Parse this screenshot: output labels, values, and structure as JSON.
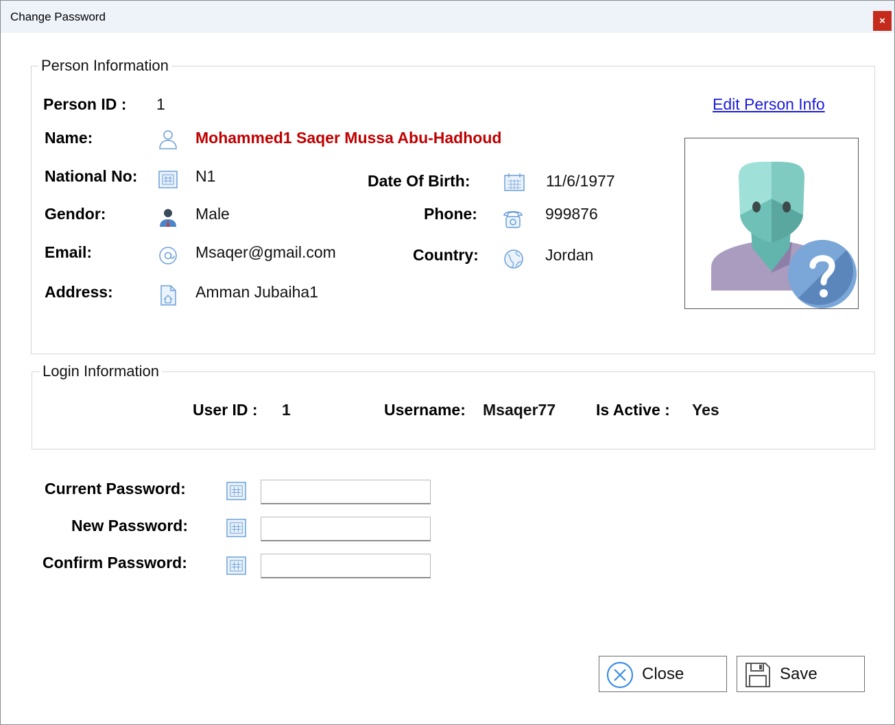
{
  "window": {
    "title": "Change Password",
    "close_glyph": "×"
  },
  "person_info": {
    "legend": "Person Information",
    "person_id_label": "Person ID :",
    "person_id": "1",
    "edit_link": "Edit Person Info",
    "name_label": "Name:",
    "name": "Mohammed1 Saqer Mussa Abu-Hadhoud",
    "national_no_label": "National No:",
    "national_no": "N1",
    "dob_label": "Date Of Birth:",
    "dob": "11/6/1977",
    "gender_label": "Gendor:",
    "gender": "Male",
    "phone_label": "Phone:",
    "phone": "999876",
    "email_label": "Email:",
    "email": "Msaqer@gmail.com",
    "country_label": "Country:",
    "country": "Jordan",
    "address_label": "Address:",
    "address": "Amman Jubaiha1"
  },
  "login_info": {
    "legend": "Login Information",
    "user_id_label": "User ID :",
    "user_id": "1",
    "username_label": "Username:",
    "username": "Msaqer77",
    "is_active_label": "Is Active :",
    "is_active": "Yes"
  },
  "password_form": {
    "current_label": "Current Password:",
    "current_value": "",
    "new_label": "New Password:",
    "new_value": "",
    "confirm_label": "Confirm Password:",
    "confirm_value": ""
  },
  "buttons": {
    "close_label": "Close",
    "save_label": "Save"
  },
  "colors": {
    "name_red": "#c00000",
    "link_blue": "#1a1adb",
    "close_red": "#c42b1c",
    "icon_blue": "#4a86c8"
  },
  "icons": [
    "person-outline-icon",
    "id-card-icon",
    "calendar-icon",
    "male-user-icon",
    "phone-icon",
    "at-sign-icon",
    "globe-icon",
    "address-doc-icon",
    "unknown-person-photo",
    "close-circle-icon",
    "save-disk-icon"
  ]
}
